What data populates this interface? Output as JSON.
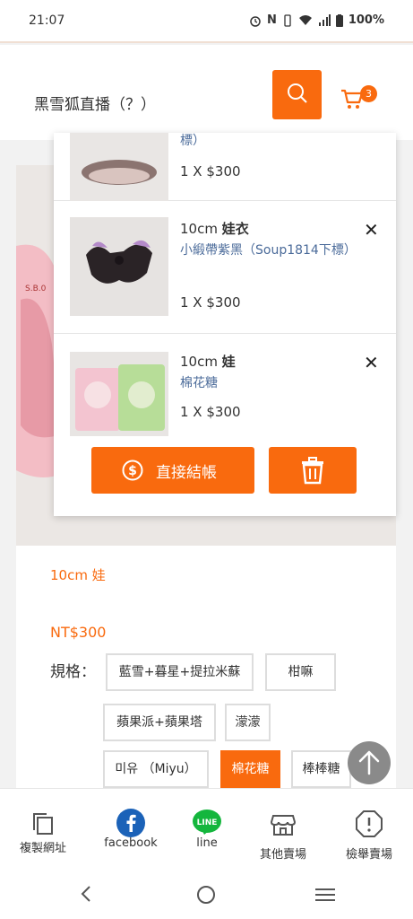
{
  "status_bar": {
    "time": "21:07",
    "battery": "100%",
    "icons": [
      "alarm-icon",
      "nfc-icon",
      "vibrate-icon",
      "wifi-icon",
      "signal-icon",
      "battery-icon"
    ]
  },
  "header": {
    "title": "黑雪狐直播（？）",
    "cart_count": "3",
    "accent": "#f96a0e"
  },
  "product": {
    "name": "10cm 娃",
    "price": "NT$300",
    "spec_label": "規格：",
    "options": [
      {
        "label": "藍雪+暮星+提拉米蘇",
        "selected": false
      },
      {
        "label": "柑嘛",
        "selected": false
      },
      {
        "label": "蘋果派+蘋果塔",
        "selected": false
      },
      {
        "label": "濛濛",
        "selected": false
      },
      {
        "label": "미유 （Miyu）",
        "selected": false
      },
      {
        "label": "棉花糖",
        "selected": true
      },
      {
        "label": "棒棒糖",
        "selected": false
      }
    ]
  },
  "cart": {
    "items": [
      {
        "name_prefix": "",
        "name_bold": "",
        "variant": "標）",
        "qty": "1 X $300"
      },
      {
        "name_prefix": "10cm ",
        "name_bold": "娃衣",
        "variant": "小緞帶紫黑（Soup1814下標）",
        "qty": "1 X $300"
      },
      {
        "name_prefix": "10cm ",
        "name_bold": "娃",
        "variant": "棉花糖",
        "qty": "1 X $300"
      }
    ],
    "checkout_label": "直接結帳"
  },
  "bottom_bar": {
    "items": [
      {
        "label": "複製網址",
        "icon": "copy-icon"
      },
      {
        "label": "facebook",
        "icon": "facebook-icon"
      },
      {
        "label": "line",
        "icon": "line-icon"
      },
      {
        "label": "其他賣場",
        "icon": "store-icon"
      },
      {
        "label": "檢舉賣場",
        "icon": "report-icon"
      }
    ]
  }
}
